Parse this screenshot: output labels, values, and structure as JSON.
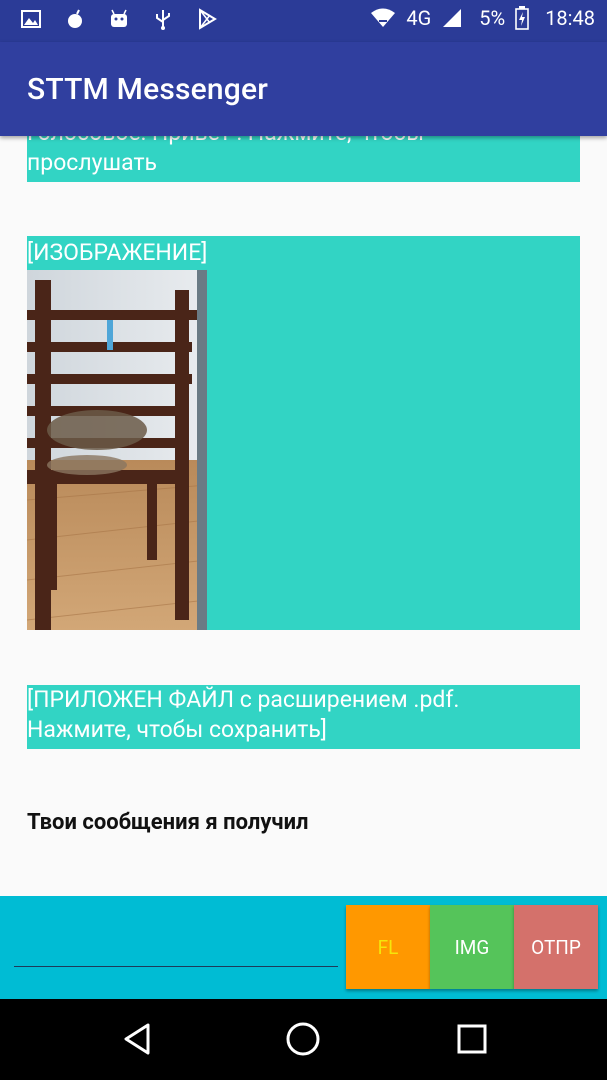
{
  "status_bar": {
    "network": "4G",
    "battery": "5%",
    "time": "18:48"
  },
  "app_bar": {
    "title": "STTM Messenger"
  },
  "messages": {
    "voice_line1": "Голосовое: Привет : Нажмите, чтобы",
    "voice_line2": "прослушать",
    "image_label": "[ИЗОБРАЖЕНИЕ]",
    "file_line1": "[ПРИЛОЖЕН ФАЙЛ с расширением .pdf.",
    "file_line2": "Нажмите, чтобы сохранить]",
    "text_message": "Твои сообщения я получил"
  },
  "input_bar": {
    "message_value": "",
    "message_placeholder": "",
    "fl_label": "FL",
    "img_label": "IMG",
    "send_label": "ОТПР"
  },
  "colors": {
    "status_bar": "#2B3B97",
    "app_bar": "#303F9F",
    "bubble": "#32D4C4",
    "input_bar": "#00BCD4",
    "fl_button": "#FF9800",
    "img_button": "#55C45A",
    "send_button": "#D4716B"
  },
  "icons": {
    "status_left": [
      "gallery-icon",
      "bomb-icon",
      "android-icon",
      "usb-icon",
      "play-store-icon"
    ],
    "status_right": [
      "wifi-icon",
      "signal-icon",
      "battery-icon"
    ],
    "nav": [
      "back-icon",
      "home-icon",
      "recents-icon"
    ]
  }
}
